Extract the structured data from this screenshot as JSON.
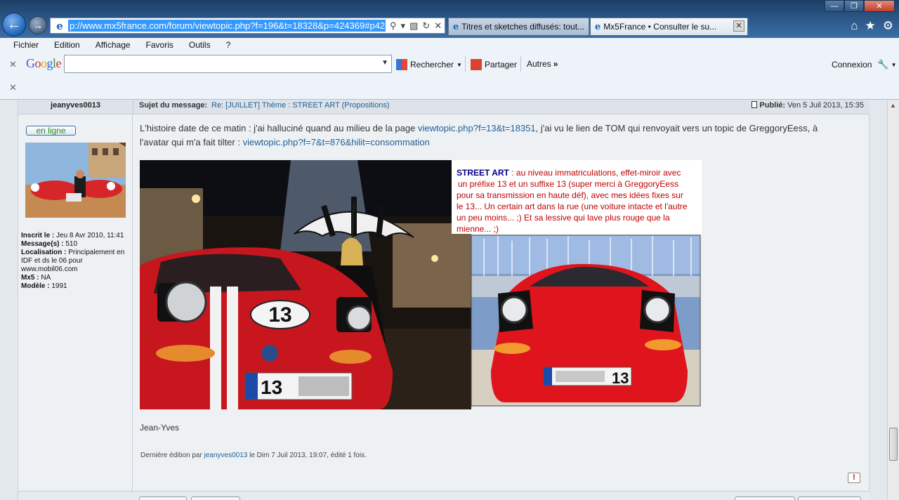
{
  "browser": {
    "url": "p://www.mx5france.com/forum/viewtopic.php?f=196&t=18328&p=424369#p424369",
    "tabs": [
      {
        "title": "Titres et sketches diffusés: tout..."
      },
      {
        "title": "Mx5France • Consulter le su..."
      }
    ],
    "menu": [
      "Fichier",
      "Edition",
      "Affichage",
      "Favoris",
      "Outils",
      "?"
    ],
    "google_bar": {
      "logo": "Google",
      "search_label": "Rechercher",
      "share_label": "Partager",
      "others_label": "Autres",
      "login_label": "Connexion"
    }
  },
  "post": {
    "author": "jeanyves0013",
    "online_label": "en ligne",
    "profile": {
      "registered_label": "Inscrit le :",
      "registered_value": "Jeu 8 Avr 2010, 11:41",
      "messages_label": "Message(s) :",
      "messages_value": "510",
      "location_label": "Localisation :",
      "location_value": "Principalement en IDF et ds le 06 pour www.mobil06.com",
      "mx5_label": "Mx5 :",
      "mx5_value": "NA",
      "model_label": "Modèle :",
      "model_value": "1991"
    },
    "subject_label": "Sujet du message:",
    "subject": "Re: [JUILLET] Thème : STREET ART (Propositions)",
    "published_label": "Publié:",
    "published_value": "Ven 5 Juil 2013, 15:35",
    "body_part1": "L'histoire date de ce matin : j'ai halluciné quand au milieu de la page ",
    "body_link1": "viewtopic.php?f=13&t=18351",
    "body_part2": ", j'ai vu le lien de TOM qui renvoyait vers un topic de GreggoryEess, à l'avatar qui m'a fait tilter : ",
    "body_link2": "viewtopic.php?f=7&t=876&hilit=consommation",
    "image_caption_title": "STREET ART",
    "image_caption_lines": [
      ": au niveau immatriculations, effet-miroir avec",
      "un préfixe 13 et un suffixe 13 (super merci à GreggoryEess",
      "pour sa transmission en haute déf), avec mes idées fixes sur",
      "le 13... Un certain art dans la rue (une voiture intacte et l'autre",
      "un peu moins...  ;) Et sa lessive qui lave plus rouge que la",
      "mienne...   ;)"
    ],
    "plate_left": "13",
    "plate_right": "13",
    "sticker_number": "13",
    "signature": "Jean-Yves",
    "edit_prefix": "Dernière édition par ",
    "edit_author": "jeanyves0013",
    "edit_suffix": " le Dim 7 Juil 2013, 19:07, édité 1 fois.",
    "report_icon": "!"
  }
}
